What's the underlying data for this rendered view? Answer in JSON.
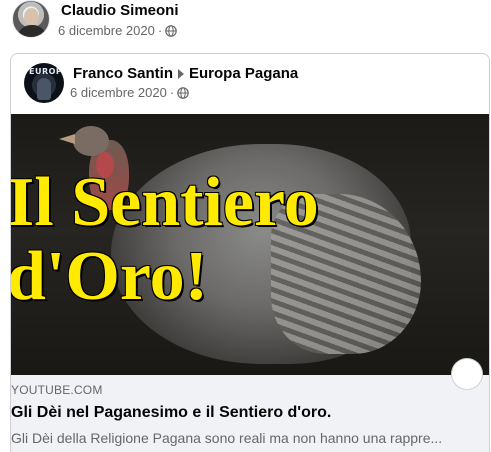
{
  "post": {
    "author": "Claudio Simeoni",
    "date": "6 dicembre 2020",
    "separator": "·",
    "privacy_icon": "globe-icon"
  },
  "shared_post": {
    "author": "Franco Santin",
    "target_group": "Europa Pagana",
    "date": "6 dicembre 2020",
    "separator": "·",
    "privacy_icon": "globe-icon",
    "avatar_text": "EUROPA"
  },
  "video_thumbnail": {
    "title_line1": "Il Sentiero",
    "title_line2": "d'Oro!"
  },
  "link_preview": {
    "domain": "YOUTUBE.COM",
    "title": "Gli Dèi nel Paganesimo e il Sentiero d'oro.",
    "description": "Gli Dèi della Religione Pagana sono reali ma non hanno una rappre..."
  },
  "colors": {
    "thumbnail_text": "#ffea00",
    "secondary_text": "#65676b",
    "preview_background": "#f0f2f5"
  }
}
